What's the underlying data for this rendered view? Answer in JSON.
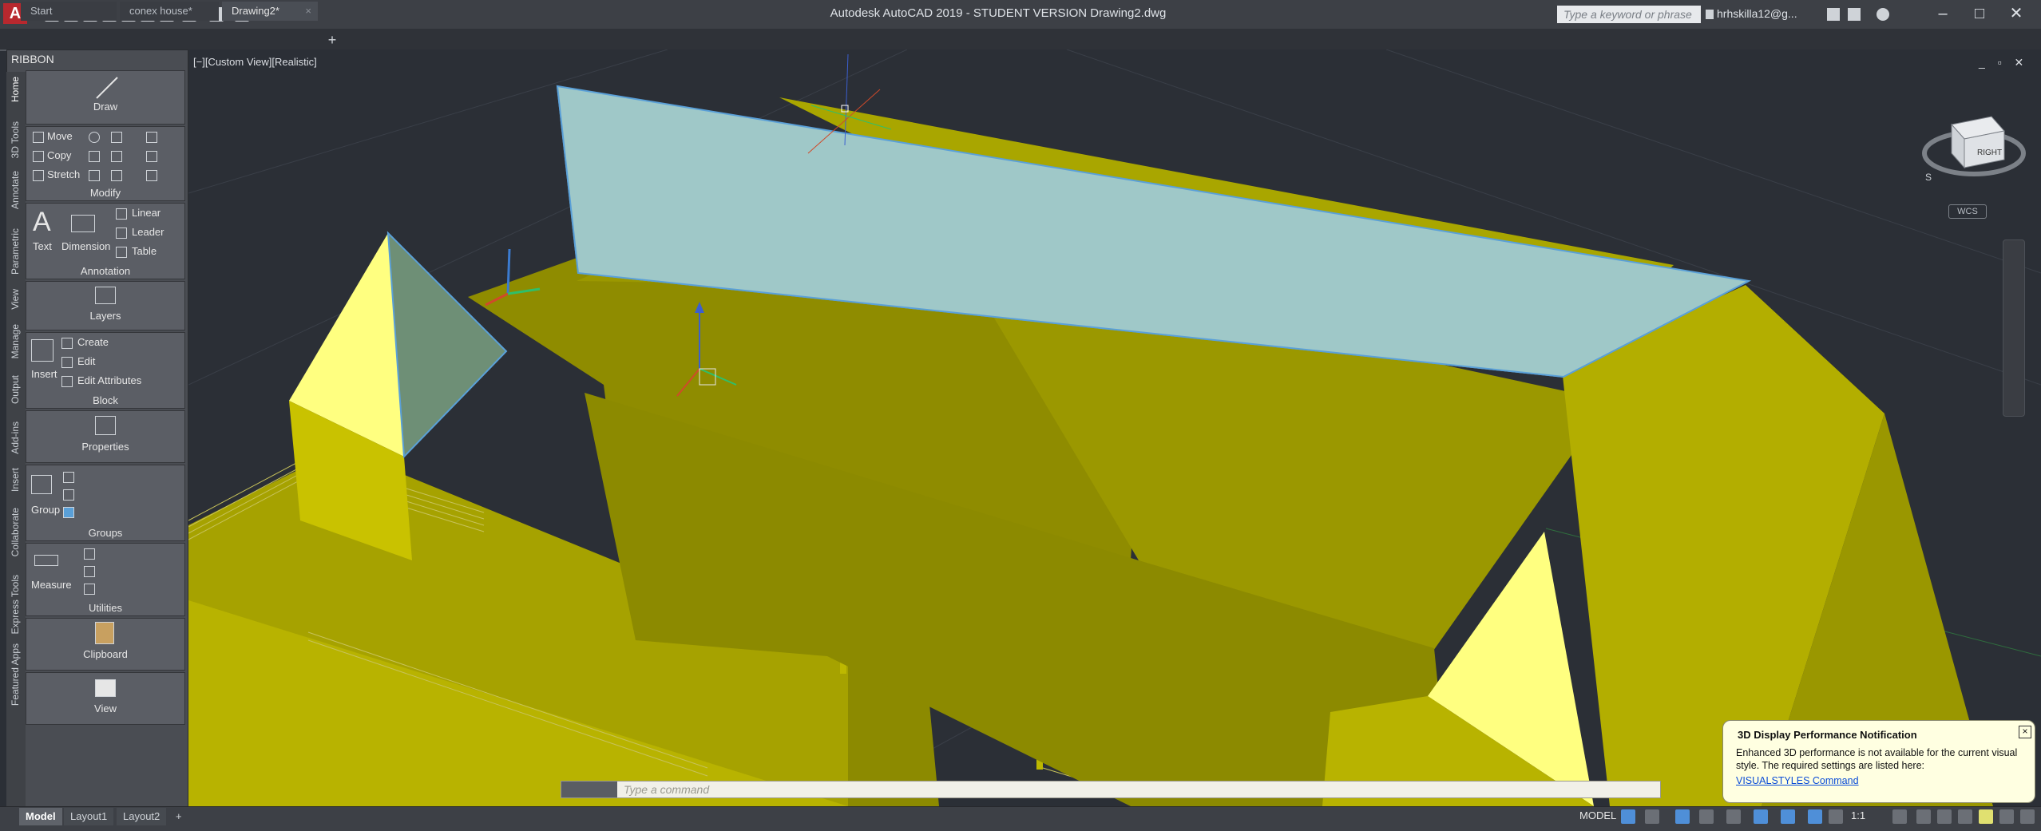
{
  "titlebar": {
    "app_logo": "A",
    "title": "Autodesk AutoCAD 2019 - STUDENT VERSION     Drawing2.dwg",
    "search_placeholder": "Type a keyword or phrase",
    "user": "hrhskilla12@g...",
    "minimize": "–",
    "maximize": "□",
    "close": "✕"
  },
  "tabs": [
    {
      "label": "Start"
    },
    {
      "label": "conex house*"
    },
    {
      "label": "Drawing2*"
    }
  ],
  "new_tab": "+",
  "ribbon": {
    "title": "RIBBON",
    "vertical_tabs": [
      "Home",
      "3D Tools",
      "Annotate",
      "Parametric",
      "View",
      "Manage",
      "Output",
      "Add-ins",
      "Insert",
      "Collaborate",
      "Express Tools",
      "Featured Apps"
    ],
    "draw": {
      "label": "Draw"
    },
    "modify": {
      "title": "Modify",
      "items": [
        "Move",
        "Copy",
        "Stretch"
      ]
    },
    "annotation": {
      "title": "Annotation",
      "text": "Text",
      "dimension": "Dimension",
      "items": [
        "Linear",
        "Leader",
        "Table"
      ]
    },
    "layers": {
      "label": "Layers"
    },
    "block": {
      "title": "Block",
      "insert": "Insert",
      "items": [
        "Create",
        "Edit",
        "Edit Attributes"
      ]
    },
    "properties": {
      "label": "Properties"
    },
    "groups": {
      "title": "Groups",
      "group": "Group"
    },
    "utilities": {
      "title": "Utilities",
      "measure": "Measure"
    },
    "clipboard": {
      "label": "Clipboard"
    },
    "view": {
      "label": "View"
    }
  },
  "viewport": {
    "label": "[−][Custom View][Realistic]",
    "controls": "_ ▫ ✕",
    "wcs": "WCS",
    "viewcube_face": "RIGHT",
    "viewcube_side": "S"
  },
  "command_line": {
    "placeholder": "Type a command"
  },
  "notification": {
    "title": "3D Display Performance Notification",
    "body": "Enhanced 3D performance is not available for the current visual style. The required settings are listed here:",
    "link": "VISUALSTYLES Command",
    "close": "×"
  },
  "statusbar": {
    "layouts": [
      "Model",
      "Layout1",
      "Layout2"
    ],
    "add_layout": "+",
    "model": "MODEL",
    "scale": "1:1"
  },
  "colors": {
    "mass_light": "#ffff80",
    "mass_mid": "#c9c200",
    "mass_dark": "#8c8a00",
    "selection": "#9fc8c8",
    "viewport_bg": "#2b2f36"
  }
}
